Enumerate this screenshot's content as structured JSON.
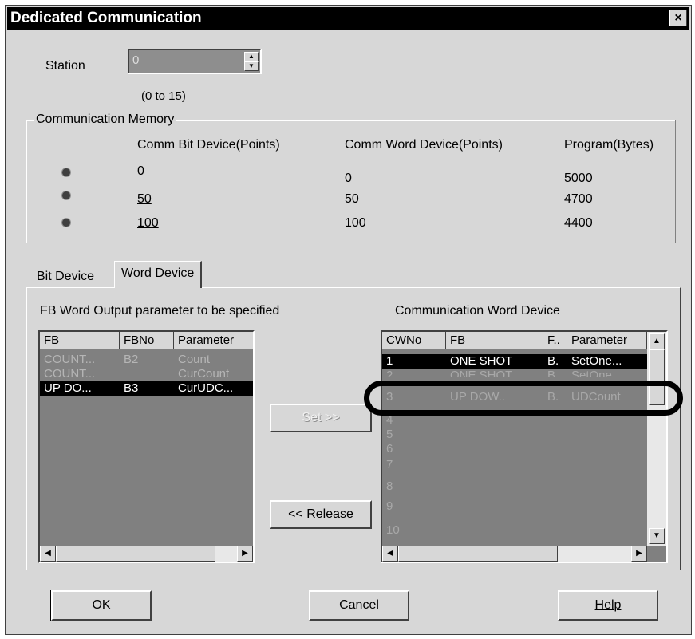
{
  "window": {
    "title": "Dedicated Communication",
    "close_glyph": "×"
  },
  "station": {
    "label": "Station",
    "value": "0",
    "range_hint": "(0 to 15)"
  },
  "comm_memory": {
    "label": "Communication Memory",
    "headers": [
      "Comm Bit Device(Points)",
      "Comm Word Device(Points)",
      "Program(Bytes)"
    ],
    "options": [
      {
        "bit": "0",
        "word": "0",
        "program": "5000"
      },
      {
        "bit": "50",
        "word": "50",
        "program": "4700"
      },
      {
        "bit": "100",
        "word": "100",
        "program": "4400"
      }
    ]
  },
  "tabs": [
    "Bit Device",
    "Word Device"
  ],
  "fb_list": {
    "label": "FB Word Output parameter to be specified",
    "columns": [
      "FB",
      "FBNo",
      "Parameter"
    ],
    "rows": [
      {
        "fb": "COUNT...",
        "fbno": "B2",
        "param": "Count"
      },
      {
        "fb": "COUNT...",
        "fbno": "",
        "param": "CurCount"
      },
      {
        "fb": "UP DO...",
        "fbno": "B3",
        "param": "CurUDC..."
      }
    ]
  },
  "buttons": {
    "set": "Set >>",
    "release": "<< Release",
    "ok": "OK",
    "cancel": "Cancel",
    "help": "Help"
  },
  "cw_list": {
    "label": "Communication Word Device",
    "columns": [
      "CWNo",
      "FB",
      "F..",
      "Parameter"
    ],
    "rows": [
      {
        "no": "1",
        "fb": "ONE SHOT",
        "f": "B.",
        "param": "SetOne..."
      },
      {
        "no": "2",
        "fb": "ONE SHOT",
        "f": "B.",
        "param": "SetOne..."
      },
      {
        "no": "3",
        "fb": "UP DOW..",
        "f": "B.",
        "param": "UDCount"
      },
      {
        "no": "4",
        "fb": "",
        "f": "",
        "param": ""
      },
      {
        "no": "5",
        "fb": "",
        "f": "",
        "param": ""
      },
      {
        "no": "6",
        "fb": "",
        "f": "",
        "param": ""
      },
      {
        "no": "7",
        "fb": "",
        "f": "",
        "param": ""
      },
      {
        "no": "8",
        "fb": "",
        "f": "",
        "param": ""
      },
      {
        "no": "9",
        "fb": "",
        "f": "",
        "param": ""
      },
      {
        "no": "10",
        "fb": "",
        "f": "",
        "param": ""
      }
    ]
  },
  "colors": {
    "dialog_bg": "#d7d7d7",
    "list_bg": "#808080",
    "selection": "#000000",
    "dim_text": "#b5b5b5"
  }
}
